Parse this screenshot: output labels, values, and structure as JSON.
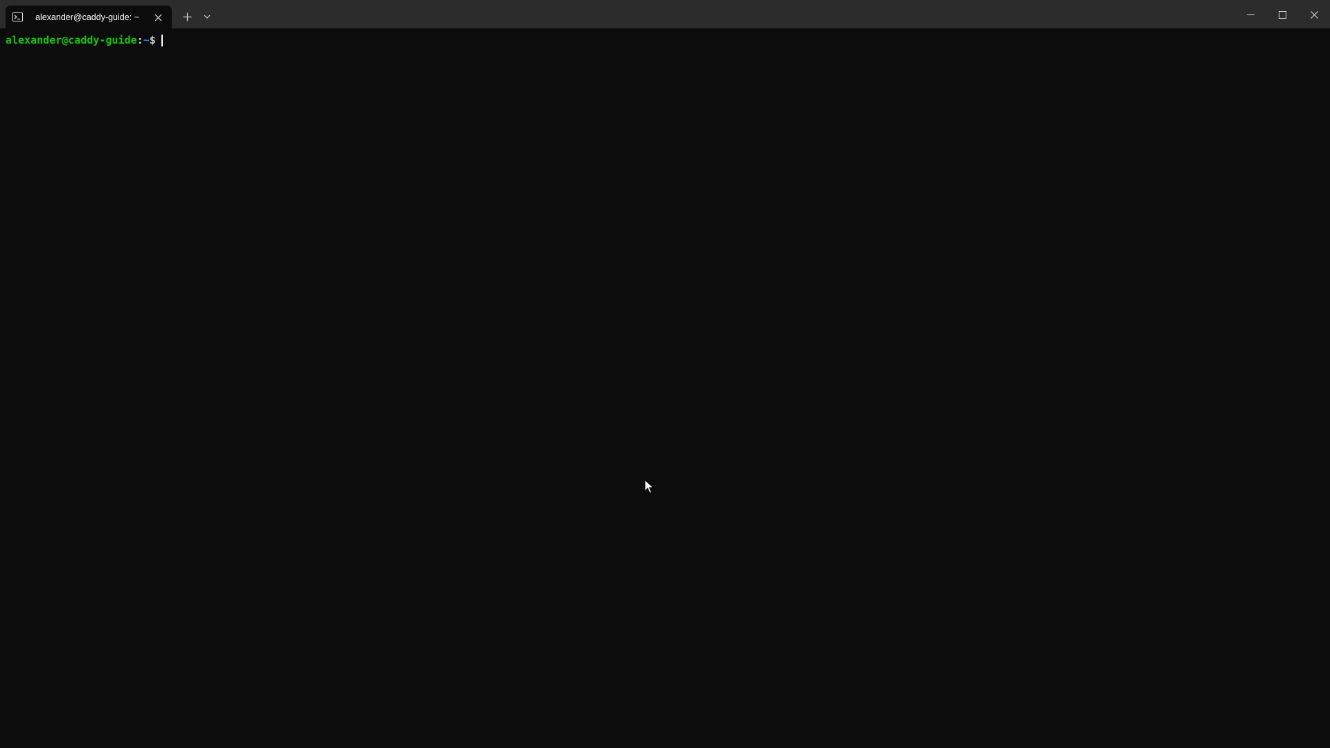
{
  "tab": {
    "title": "alexander@caddy-guide: ~",
    "icon": "terminal-icon"
  },
  "toolbar": {
    "new_tab_icon": "plus-icon",
    "dropdown_icon": "chevron-down-icon"
  },
  "window_controls": {
    "minimize_icon": "minimize-icon",
    "maximize_icon": "maximize-icon",
    "close_icon": "close-icon"
  },
  "terminal": {
    "prompt_user": "alexander@caddy-guide",
    "prompt_sep": ":",
    "prompt_path": "~",
    "prompt_symbol": "$",
    "input": ""
  },
  "colors": {
    "titlebar": "#2c2c2c",
    "background": "#0c0c0c",
    "prompt_user": "#16c60c",
    "prompt_path": "#3b78ff",
    "text": "#cccccc"
  }
}
